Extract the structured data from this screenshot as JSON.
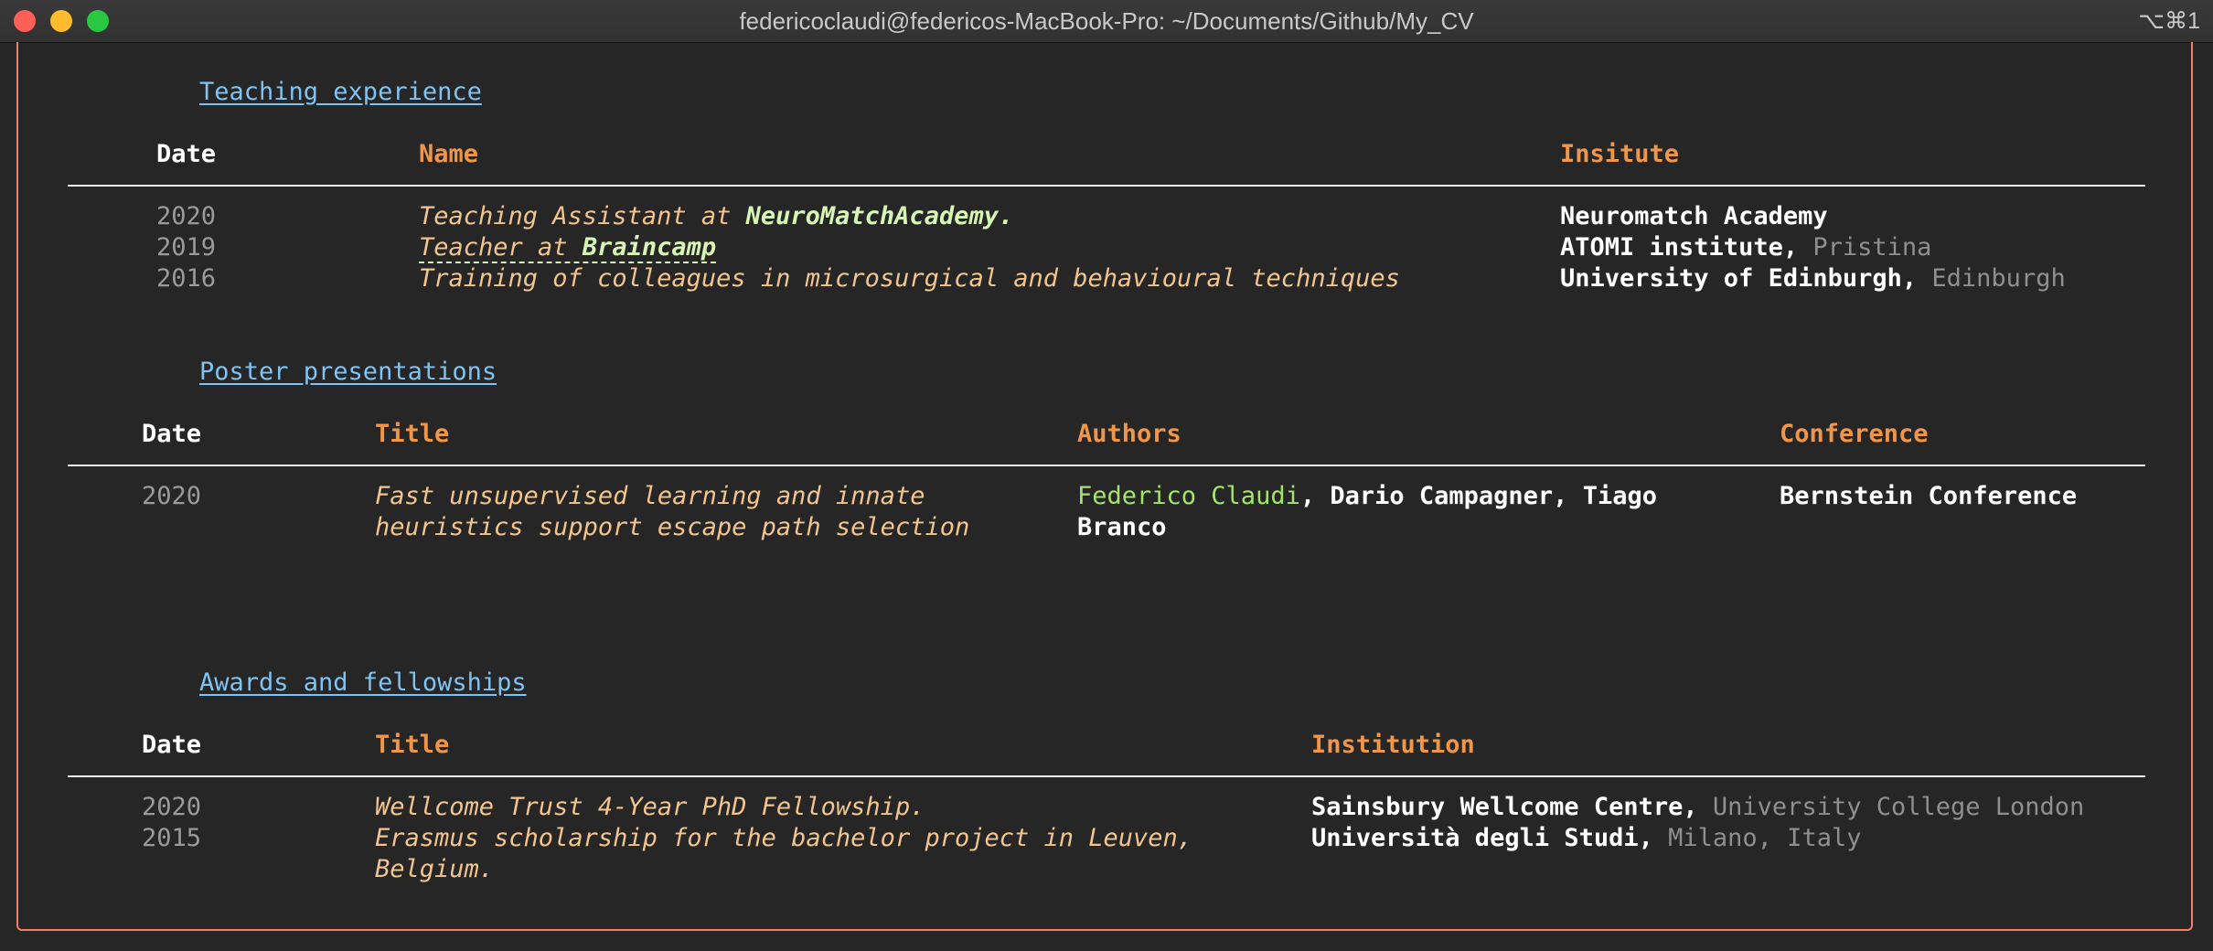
{
  "window": {
    "title": "federicoclaudi@federicos-MacBook-Pro: ~/Documents/Github/My_CV",
    "shortcut": "⌥⌘1"
  },
  "teaching": {
    "heading": "Teaching experience",
    "columns": {
      "date": "Date",
      "name": "Name",
      "institute": "Insitute"
    },
    "rows": [
      {
        "date": "2020",
        "pre": "Teaching Assistant at ",
        "strong": "NeuroMatchAcademy.",
        "institution": "Neuromatch Academy",
        "city": ""
      },
      {
        "date": "2019",
        "pre": "Teacher at ",
        "strong": "Braincamp",
        "institution": "ATOMI institute,",
        "city": "Pristina"
      },
      {
        "date": "2016",
        "pre": "Training of colleagues in microsurgical and behavioural techniques",
        "strong": "",
        "institution": "University of Edinburgh,",
        "city": "Edinburgh"
      }
    ]
  },
  "posters": {
    "heading": "Poster presentations",
    "columns": {
      "date": "Date",
      "title": "Title",
      "authors": "Authors",
      "conference": "Conference"
    },
    "rows": [
      {
        "date": "2020",
        "title_line1": "Fast unsupervised learning and innate",
        "title_line2": "heuristics support escape path selection",
        "author_highlight": "Federico Claudi",
        "authors_rest_line1": ", Dario Campagner, Tiago",
        "authors_line2": "Branco",
        "conference": "Bernstein Conference"
      }
    ]
  },
  "awards": {
    "heading": "Awards and fellowships",
    "columns": {
      "date": "Date",
      "title": "Title",
      "institution": "Institution"
    },
    "rows": [
      {
        "date": "2020",
        "title_line1": "Wellcome Trust 4-Year PhD Fellowship.",
        "title_line2": "",
        "institution": "Sainsbury Wellcome Centre,",
        "city": "University College London"
      },
      {
        "date": "2015",
        "title_line1": "Erasmus scholarship for the bachelor project in Leuven,",
        "title_line2": "Belgium.",
        "institution": "Università degli Studi,",
        "city": "Milano, Italy"
      }
    ]
  }
}
